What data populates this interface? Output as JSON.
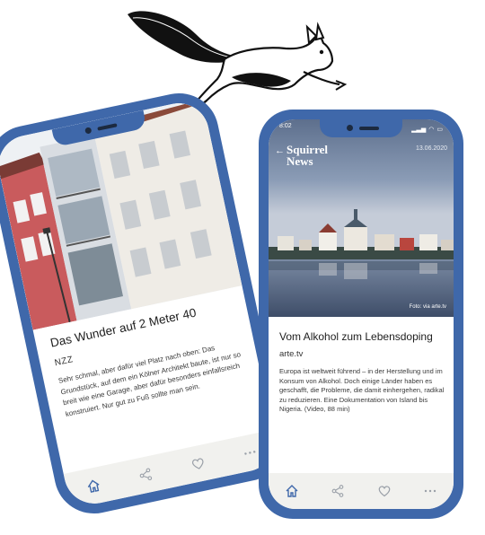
{
  "left_phone": {
    "article": {
      "title": "Das Wunder auf 2 Meter 40",
      "source": "NZZ",
      "text": "Sehr schmal, aber dafür viel Platz nach oben: Das Grundstück, auf dem ein Kölner Architekt baute, ist nur so breit wie eine Garage, aber dafür besonders einfallsreich konstruiert. Nur gut zu Fuß sollte man sein."
    },
    "tabbar": [
      {
        "icon": "home-icon",
        "active": true
      },
      {
        "icon": "share-icon",
        "active": false
      },
      {
        "icon": "heart-icon",
        "active": false
      },
      {
        "icon": "more-icon",
        "active": false
      }
    ]
  },
  "right_phone": {
    "status": {
      "time": "8:02"
    },
    "brand_line1": "Squirrel",
    "brand_line2": "News",
    "date": "13.06.2020",
    "photo_credit": "Foto: via arte.tv",
    "article": {
      "title": "Vom Alkohol zum Lebensdoping",
      "source": "arte.tv",
      "text": "Europa ist weltweit führend – in der Herstellung und im Konsum von Alkohol. Doch einige Länder haben es geschafft, die Probleme, die damit einhergehen, radikal zu reduzieren. Eine Dokumentation von Island bis Nigeria. (Video, 88 min)"
    },
    "tabbar": [
      {
        "icon": "home-icon",
        "active": true
      },
      {
        "icon": "share-icon",
        "active": false
      },
      {
        "icon": "heart-icon",
        "active": false
      },
      {
        "icon": "more-icon",
        "active": false
      }
    ]
  },
  "colors": {
    "phone_frame": "#3f68aa",
    "tabbar": "#f1f1ee",
    "active_icon": "#3f68aa"
  }
}
